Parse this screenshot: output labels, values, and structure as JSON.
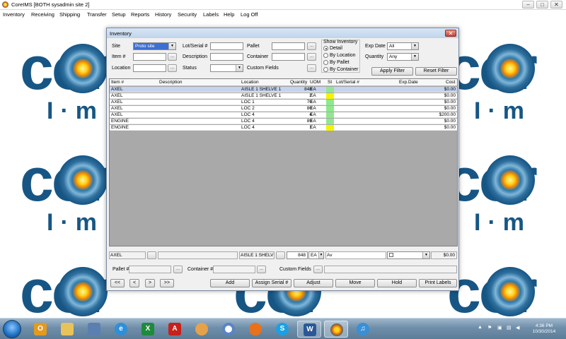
{
  "app": {
    "title": "CoreIMS [BOTH sysadmin  site 2]",
    "window_buttons": [
      "–",
      "□",
      "✕"
    ]
  },
  "menu": [
    "Inventory",
    "Receiving",
    "Shipping",
    "Transfer",
    "Setup",
    "Reports",
    "History",
    "Security",
    "Labels",
    "Help",
    "Log Off"
  ],
  "background": {
    "logo_text": "cor",
    "logo_sub": "I·m"
  },
  "window": {
    "title": "Inventory",
    "close": "✕"
  },
  "filters": {
    "site_label": "Site",
    "site_value": "Proto site",
    "item_label": "Item #",
    "item_value": "",
    "location_label": "Location",
    "location_value": "",
    "lot_label": "Lot/Serial #",
    "lot_value": "",
    "description_label": "Description",
    "description_value": "",
    "status_label": "Status",
    "status_value": "",
    "pallet_label": "Pallet",
    "pallet_value": "",
    "container_label": "Container",
    "container_value": "",
    "custom_fields_label": "Custom Fields",
    "ellipsis": "...",
    "show_inventory_label": "Show Inventory",
    "show_options": [
      "Detail",
      "By Location",
      "By Pallet",
      "By Container"
    ],
    "show_selected": 0,
    "exp_date_label": "Exp Date",
    "exp_date_value": "All",
    "quantity_label": "Quantity",
    "quantity_value": "Any",
    "apply_button": "Apply Filter",
    "reset_button": "Reset Filter"
  },
  "grid": {
    "columns": [
      "Item #",
      "Description",
      "Location",
      "Quantity",
      "UOM",
      "St",
      "Lot/Serial #",
      "Exp.Date",
      "Cost"
    ],
    "rows": [
      {
        "item": "AXEL",
        "description": "",
        "location": "AISLE 1 SHELVE 1",
        "quantity": "848",
        "uom": "EA",
        "status_color": "#8fe88f",
        "lot": "",
        "exp": "",
        "cost": "$0.00",
        "selected": true
      },
      {
        "item": "AXEL",
        "description": "",
        "location": "AISLE 1 SHELVE 1",
        "quantity": "2",
        "uom": "EA",
        "status_color": "#f4f400",
        "lot": "",
        "exp": "",
        "cost": "$0.00",
        "selected": false
      },
      {
        "item": "AXEL",
        "description": "",
        "location": "LOC 1",
        "quantity": "70",
        "uom": "EA",
        "status_color": "#8fe88f",
        "lot": "",
        "exp": "",
        "cost": "$0.00",
        "selected": false
      },
      {
        "item": "AXEL",
        "description": "",
        "location": "LOC 2",
        "quantity": "80",
        "uom": "EA",
        "status_color": "#8fe88f",
        "lot": "",
        "exp": "",
        "cost": "$0.00",
        "selected": false
      },
      {
        "item": "AXEL",
        "description": "",
        "location": "LOC 4",
        "quantity": "4",
        "uom": "EA",
        "status_color": "#8fe88f",
        "lot": "",
        "exp": "",
        "cost": "$200.00",
        "selected": false
      },
      {
        "item": "ENGINE",
        "description": "",
        "location": "LOC 4",
        "quantity": "89",
        "uom": "EA",
        "status_color": "#8fe88f",
        "lot": "",
        "exp": "",
        "cost": "$0.00",
        "selected": false
      },
      {
        "item": "ENGINE",
        "description": "",
        "location": "LOC 4",
        "quantity": "1",
        "uom": "EA",
        "status_color": "#f4f400",
        "lot": "",
        "exp": "",
        "cost": "$0.00",
        "selected": false
      }
    ]
  },
  "edit_row": {
    "item": "AXEL",
    "location": "AISLE 1 SHELV",
    "quantity": "848",
    "uom": "EA",
    "status": "Av",
    "cost": "$0.00"
  },
  "bottom": {
    "pallet_label": "Pallet #",
    "container_label": "Container #",
    "custom_fields_label": "Custom Fields",
    "nav": [
      "<<",
      "<",
      ">",
      ">>"
    ],
    "actions": [
      "Add",
      "Assign Serial #",
      "Adjust",
      "Move",
      "Hold",
      "Print Labels"
    ]
  },
  "taskbar": {
    "time": "4:36 PM",
    "date": "10/30/2014"
  }
}
